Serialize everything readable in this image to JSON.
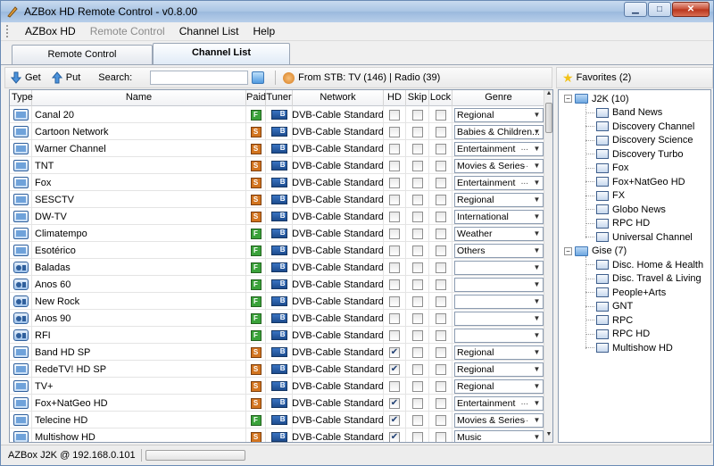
{
  "window": {
    "title": "AZBox HD Remote Control - v0.8.00"
  },
  "menu": {
    "items": [
      "AZBox HD",
      "Remote Control",
      "Channel List",
      "Help"
    ]
  },
  "tabs": [
    "Remote Control",
    "Channel List"
  ],
  "toolbar": {
    "get_label": "Get",
    "put_label": "Put",
    "search_label": "Search:",
    "search_value": "",
    "stb_info": "From STB: TV (146) | Radio (39)"
  },
  "columns": {
    "type": "Type",
    "name": "Name",
    "paid": "Paid",
    "tuner": "Tuner",
    "network": "Network",
    "hd": "HD",
    "skip": "Skip",
    "lock": "Lock",
    "genre": "Genre"
  },
  "channels": [
    {
      "type": "tv",
      "name": "Canal 20",
      "paid": "F",
      "network": "DVB-Cable Standard",
      "hd": false,
      "skip": false,
      "lock": false,
      "genre": "Regional",
      "more": ""
    },
    {
      "type": "tv",
      "name": "Cartoon Network",
      "paid": "S",
      "network": "DVB-Cable Standard",
      "hd": false,
      "skip": false,
      "lock": false,
      "genre": "Babies & Children...",
      "more": ""
    },
    {
      "type": "tv",
      "name": "Warner Channel",
      "paid": "S",
      "network": "DVB-Cable Standard",
      "hd": false,
      "skip": false,
      "lock": false,
      "genre": "Entertainment",
      "more": "..."
    },
    {
      "type": "tv",
      "name": "TNT",
      "paid": "S",
      "network": "DVB-Cable Standard",
      "hd": false,
      "skip": false,
      "lock": false,
      "genre": "Movies & Series",
      "more": "..."
    },
    {
      "type": "tv",
      "name": "Fox",
      "paid": "S",
      "network": "DVB-Cable Standard",
      "hd": false,
      "skip": false,
      "lock": false,
      "genre": "Entertainment",
      "more": "..."
    },
    {
      "type": "tv",
      "name": "SESCTV",
      "paid": "S",
      "network": "DVB-Cable Standard",
      "hd": false,
      "skip": false,
      "lock": false,
      "genre": "Regional",
      "more": ""
    },
    {
      "type": "tv",
      "name": "DW-TV",
      "paid": "S",
      "network": "DVB-Cable Standard",
      "hd": false,
      "skip": false,
      "lock": false,
      "genre": "International",
      "more": ""
    },
    {
      "type": "tv",
      "name": "Climatempo",
      "paid": "F",
      "network": "DVB-Cable Standard",
      "hd": false,
      "skip": false,
      "lock": false,
      "genre": "Weather",
      "more": ""
    },
    {
      "type": "tv",
      "name": "Esotérico",
      "paid": "F",
      "network": "DVB-Cable Standard",
      "hd": false,
      "skip": false,
      "lock": false,
      "genre": "Others",
      "more": ""
    },
    {
      "type": "radio",
      "name": "Baladas",
      "paid": "F",
      "network": "DVB-Cable Standard",
      "hd": false,
      "skip": false,
      "lock": false,
      "genre": "",
      "more": ""
    },
    {
      "type": "radio",
      "name": "Anos 60",
      "paid": "F",
      "network": "DVB-Cable Standard",
      "hd": false,
      "skip": false,
      "lock": false,
      "genre": "",
      "more": ""
    },
    {
      "type": "radio",
      "name": "New Rock",
      "paid": "F",
      "network": "DVB-Cable Standard",
      "hd": false,
      "skip": false,
      "lock": false,
      "genre": "",
      "more": ""
    },
    {
      "type": "radio",
      "name": "Anos 90",
      "paid": "F",
      "network": "DVB-Cable Standard",
      "hd": false,
      "skip": false,
      "lock": false,
      "genre": "",
      "more": ""
    },
    {
      "type": "radio",
      "name": "RFI",
      "paid": "F",
      "network": "DVB-Cable Standard",
      "hd": false,
      "skip": false,
      "lock": false,
      "genre": "",
      "more": ""
    },
    {
      "type": "tv",
      "name": "Band HD SP",
      "paid": "S",
      "network": "DVB-Cable Standard",
      "hd": true,
      "skip": false,
      "lock": false,
      "genre": "Regional",
      "more": ""
    },
    {
      "type": "tv",
      "name": "RedeTV! HD SP",
      "paid": "S",
      "network": "DVB-Cable Standard",
      "hd": true,
      "skip": false,
      "lock": false,
      "genre": "Regional",
      "more": ""
    },
    {
      "type": "tv",
      "name": "TV+",
      "paid": "S",
      "network": "DVB-Cable Standard",
      "hd": false,
      "skip": false,
      "lock": false,
      "genre": "Regional",
      "more": ""
    },
    {
      "type": "tv",
      "name": "Fox+NatGeo HD",
      "paid": "S",
      "network": "DVB-Cable Standard",
      "hd": true,
      "skip": false,
      "lock": false,
      "genre": "Entertainment",
      "more": "..."
    },
    {
      "type": "tv",
      "name": "Telecine HD",
      "paid": "F",
      "network": "DVB-Cable Standard",
      "hd": true,
      "skip": false,
      "lock": false,
      "genre": "Movies & Series",
      "more": "..."
    },
    {
      "type": "tv",
      "name": "Multishow HD",
      "paid": "S",
      "network": "DVB-Cable Standard",
      "hd": true,
      "skip": false,
      "lock": false,
      "genre": "Music",
      "more": ""
    }
  ],
  "favorites": {
    "title": "Favorites (2)",
    "groups": [
      {
        "name": "J2K (10)",
        "items": [
          "Band News",
          "Discovery Channel",
          "Discovery Science",
          "Discovery Turbo",
          "Fox",
          "Fox+NatGeo HD",
          "FX",
          "Globo News",
          "RPC HD",
          "Universal Channel"
        ]
      },
      {
        "name": "Gise (7)",
        "items": [
          "Disc. Home & Health",
          "Disc. Travel & Living",
          "People+Arts",
          "GNT",
          "RPC",
          "RPC HD",
          "Multishow HD"
        ]
      }
    ]
  },
  "status": {
    "text": "AZBox J2K @ 192.168.0.101",
    "progress": 0
  },
  "colors": {
    "paid_free": "#3aa23a",
    "paid_subscription": "#d2741f",
    "title_bar": "#a9c4e4"
  }
}
